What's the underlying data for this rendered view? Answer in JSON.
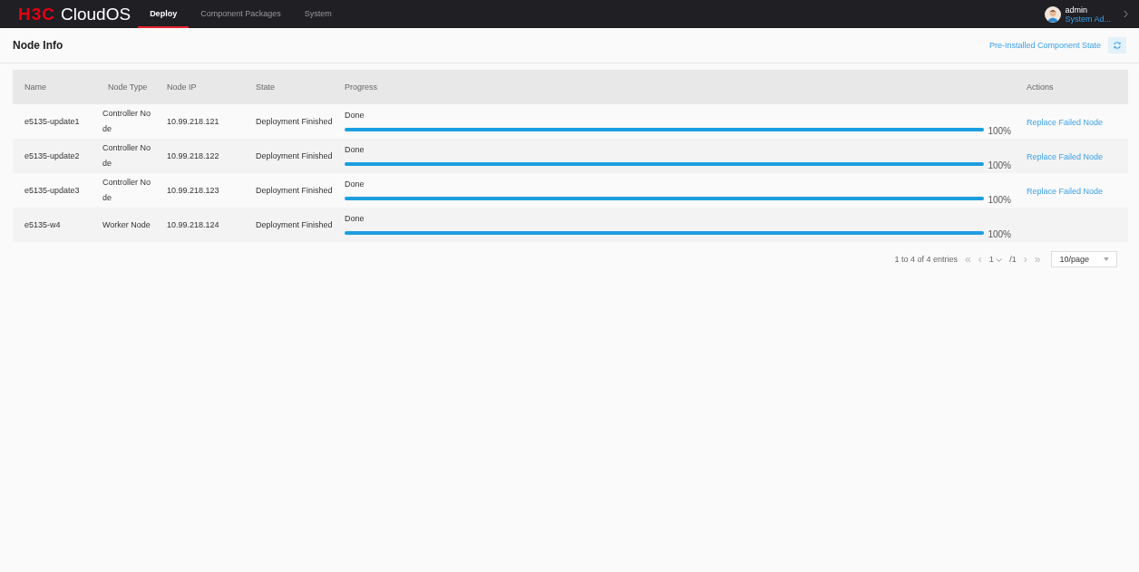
{
  "topbar": {
    "logo_mark": "H3C",
    "logo_text": "CloudOS",
    "tabs": [
      {
        "label": "Deploy",
        "selected": true
      },
      {
        "label": "Component Packages",
        "selected": false
      },
      {
        "label": "System",
        "selected": false
      }
    ],
    "user": {
      "name": "admin",
      "role": "System Ad..."
    }
  },
  "page": {
    "title": "Node Info",
    "link": "Pre-Installed Component State"
  },
  "table": {
    "columns": [
      "Name",
      "Node Type",
      "Node IP",
      "State",
      "Progress",
      "Actions"
    ],
    "rows": [
      {
        "name": "e5135-update1",
        "node_type": "Controller Node",
        "ip": "10.99.218.121",
        "state": "Deployment Finished",
        "progress_label": "Done",
        "level": 1,
        "percent": "100%",
        "action": "Replace Failed Node"
      },
      {
        "name": "e5135-update2",
        "node_type": "Controller Node",
        "ip": "10.99.218.122",
        "state": "Deployment Finished",
        "progress_label": "Done",
        "level": 1,
        "percent": "100%",
        "action": "Replace Failed Node"
      },
      {
        "name": "e5135-update3",
        "node_type": "Controller Node",
        "ip": "10.99.218.123",
        "state": "Deployment Finished",
        "progress_label": "Done",
        "level": 1,
        "percent": "100%",
        "action": "Replace Failed Node"
      },
      {
        "name": "e5135-w4",
        "node_type": "Worker Node",
        "ip": "10.99.218.124",
        "state": "Deployment Finished",
        "progress_label": "Done",
        "level": 1,
        "percent": "100%"
      }
    ]
  },
  "pagination": {
    "summary": "1 to 4 of 4 entries",
    "first": "«",
    "prev": "‹",
    "page": "1",
    "total": "/1",
    "next": "›",
    "last": "»",
    "page_size": "10/page"
  }
}
